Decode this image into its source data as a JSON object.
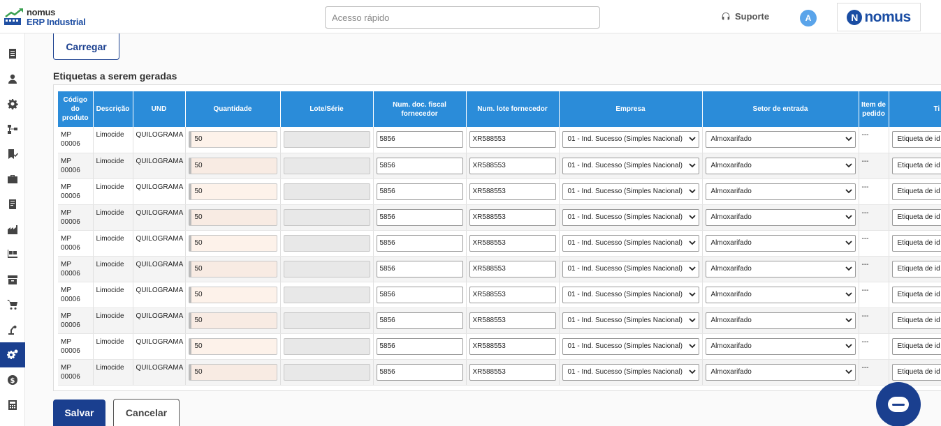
{
  "header": {
    "logo_line1": "nomus",
    "logo_line2": "ERP Industrial",
    "search_placeholder": "Acesso rápido",
    "support_label": "Suporte",
    "avatar_initial": "A",
    "brand_initial": "N",
    "brand_text": "nomus"
  },
  "sidebar": {
    "items": [
      {
        "icon": "document-icon"
      },
      {
        "icon": "user-icon"
      },
      {
        "icon": "gear-icon"
      },
      {
        "icon": "workflow-icon"
      },
      {
        "icon": "bookmark-check-icon"
      },
      {
        "icon": "briefcase-icon"
      },
      {
        "icon": "book-icon"
      },
      {
        "icon": "factory-icon"
      },
      {
        "icon": "pallet-icon"
      },
      {
        "icon": "archive-icon"
      },
      {
        "icon": "cart-icon"
      },
      {
        "icon": "robot-arm-icon"
      },
      {
        "icon": "gears-icon",
        "active": true
      },
      {
        "icon": "dollar-icon"
      },
      {
        "icon": "calculator-icon"
      }
    ]
  },
  "main": {
    "load_button": "Carregar",
    "section_title": "Etiquetas a serem geradas",
    "columns": [
      "Código do produto",
      "Descrição",
      "UND",
      "Quantidade",
      "Lote/Série",
      "Num. doc. fiscal fornecedor",
      "Num. lote fornecedor",
      "Empresa",
      "Setor de entrada",
      "Item de pedido",
      "Ti"
    ],
    "rows": [
      {
        "codigo": "MP 00006",
        "descricao": "Limocide",
        "und": "QUILOGRAMA",
        "quantidade": "50",
        "doc": "5856",
        "lote_forn": "XR588553",
        "empresa": "01 - Ind. Sucesso (Simples Nacional)",
        "setor": "Almoxarifado",
        "item": "---",
        "tipo": "Etiqueta de id"
      },
      {
        "codigo": "MP 00006",
        "descricao": "Limocide",
        "und": "QUILOGRAMA",
        "quantidade": "50",
        "doc": "5856",
        "lote_forn": "XR588553",
        "empresa": "01 - Ind. Sucesso (Simples Nacional)",
        "setor": "Almoxarifado",
        "item": "---",
        "tipo": "Etiqueta de id"
      },
      {
        "codigo": "MP 00006",
        "descricao": "Limocide",
        "und": "QUILOGRAMA",
        "quantidade": "50",
        "doc": "5856",
        "lote_forn": "XR588553",
        "empresa": "01 - Ind. Sucesso (Simples Nacional)",
        "setor": "Almoxarifado",
        "item": "---",
        "tipo": "Etiqueta de id"
      },
      {
        "codigo": "MP 00006",
        "descricao": "Limocide",
        "und": "QUILOGRAMA",
        "quantidade": "50",
        "doc": "5856",
        "lote_forn": "XR588553",
        "empresa": "01 - Ind. Sucesso (Simples Nacional)",
        "setor": "Almoxarifado",
        "item": "---",
        "tipo": "Etiqueta de id"
      },
      {
        "codigo": "MP 00006",
        "descricao": "Limocide",
        "und": "QUILOGRAMA",
        "quantidade": "50",
        "doc": "5856",
        "lote_forn": "XR588553",
        "empresa": "01 - Ind. Sucesso (Simples Nacional)",
        "setor": "Almoxarifado",
        "item": "---",
        "tipo": "Etiqueta de id"
      },
      {
        "codigo": "MP 00006",
        "descricao": "Limocide",
        "und": "QUILOGRAMA",
        "quantidade": "50",
        "doc": "5856",
        "lote_forn": "XR588553",
        "empresa": "01 - Ind. Sucesso (Simples Nacional)",
        "setor": "Almoxarifado",
        "item": "---",
        "tipo": "Etiqueta de id"
      },
      {
        "codigo": "MP 00006",
        "descricao": "Limocide",
        "und": "QUILOGRAMA",
        "quantidade": "50",
        "doc": "5856",
        "lote_forn": "XR588553",
        "empresa": "01 - Ind. Sucesso (Simples Nacional)",
        "setor": "Almoxarifado",
        "item": "---",
        "tipo": "Etiqueta de id"
      },
      {
        "codigo": "MP 00006",
        "descricao": "Limocide",
        "und": "QUILOGRAMA",
        "quantidade": "50",
        "doc": "5856",
        "lote_forn": "XR588553",
        "empresa": "01 - Ind. Sucesso (Simples Nacional)",
        "setor": "Almoxarifado",
        "item": "---",
        "tipo": "Etiqueta de id"
      },
      {
        "codigo": "MP 00006",
        "descricao": "Limocide",
        "und": "QUILOGRAMA",
        "quantidade": "50",
        "doc": "5856",
        "lote_forn": "XR588553",
        "empresa": "01 - Ind. Sucesso (Simples Nacional)",
        "setor": "Almoxarifado",
        "item": "---",
        "tipo": "Etiqueta de id"
      },
      {
        "codigo": "MP 00006",
        "descricao": "Limocide",
        "und": "QUILOGRAMA",
        "quantidade": "50",
        "doc": "5856",
        "lote_forn": "XR588553",
        "empresa": "01 - Ind. Sucesso (Simples Nacional)",
        "setor": "Almoxarifado",
        "item": "---",
        "tipo": "Etiqueta de id"
      }
    ],
    "save_button": "Salvar",
    "cancel_button": "Cancelar"
  },
  "colors": {
    "primary": "#1a3f8f",
    "table_header": "#2b8cd9",
    "avatar": "#5aa4ea"
  }
}
